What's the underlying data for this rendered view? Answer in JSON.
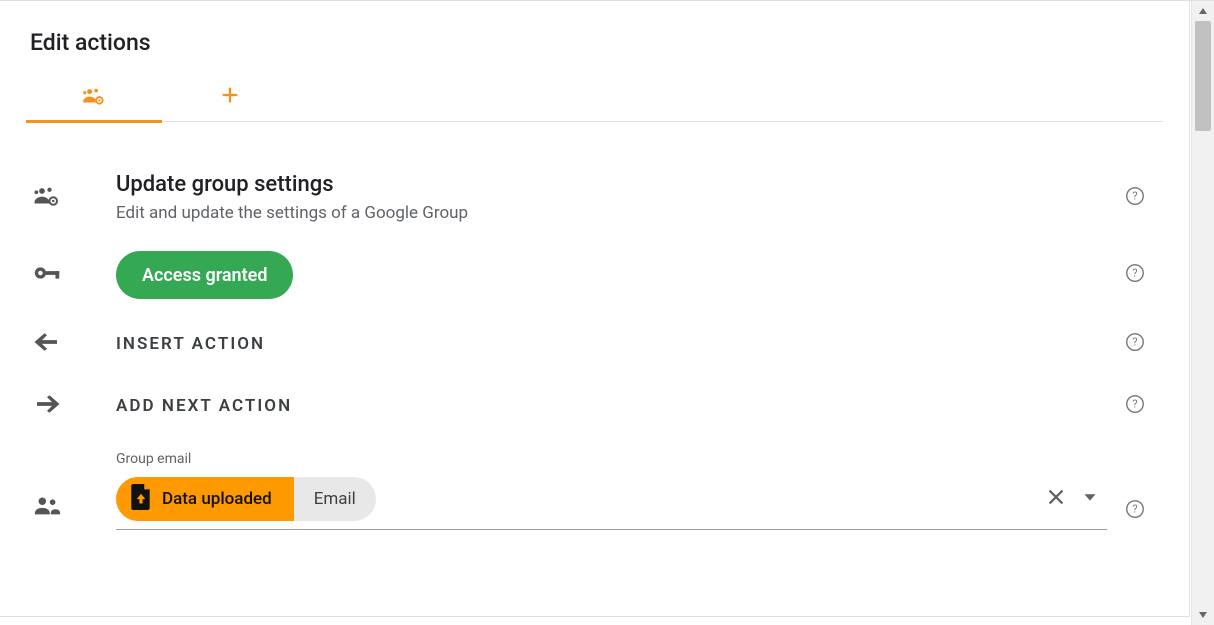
{
  "page": {
    "title": "Edit actions"
  },
  "tabs": [
    {
      "id": "group-settings",
      "icon": "group-settings-icon",
      "active": true
    },
    {
      "id": "add",
      "icon": "plus-icon",
      "active": false
    }
  ],
  "action": {
    "title": "Update group settings",
    "subtitle": "Edit and update the settings of a Google Group"
  },
  "access": {
    "badge_label": "Access granted"
  },
  "insert": {
    "label": "INSERT ACTION"
  },
  "add_next": {
    "label": "ADD NEXT ACTION"
  },
  "field": {
    "label": "Group email",
    "chip_primary": "Data uploaded",
    "chip_secondary": "Email"
  }
}
